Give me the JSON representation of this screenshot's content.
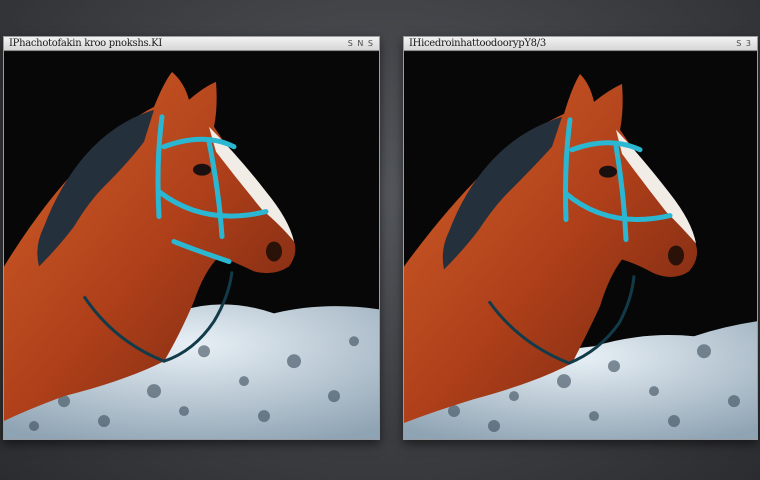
{
  "windows": [
    {
      "title": "IPhachotofakin kroo pnokshs.KI",
      "controls": "S N  S"
    },
    {
      "title": "IHicedroinhattoodoorypY8/3",
      "controls": "S  3"
    }
  ],
  "colors": {
    "desktop": "#3e4044",
    "window_background": "#0b0b0b",
    "horse_coat": "#b9491c",
    "bridle": "#2bb7d2",
    "mane": "#2a3540",
    "snow": "#c9d6e0"
  },
  "icons": [
    "window-controls-icon"
  ]
}
